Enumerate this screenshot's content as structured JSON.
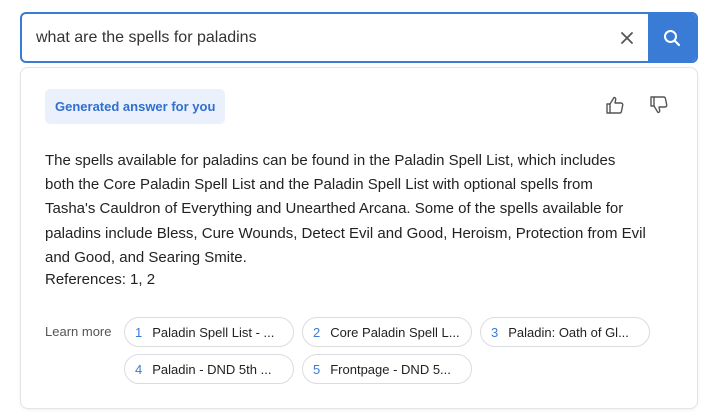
{
  "search": {
    "query": "what are the spells for paladins"
  },
  "answer_card": {
    "badge": "Generated answer for you",
    "lines": [
      "The spells available for paladins can be found in the Paladin Spell List, which includes",
      "both the Core Paladin Spell List and the Paladin Spell List with optional spells from",
      "Tasha's Cauldron of Everything and Unearthed Arcana. Some of the spells available for",
      "paladins include Bless, Cure Wounds, Detect Evil and Good, Heroism, Protection from Evil",
      "and Good, and Searing Smite."
    ],
    "references": "References: 1, 2",
    "learn_more_label": "Learn more",
    "sources": [
      {
        "num": "1",
        "title": "Paladin Spell List - ..."
      },
      {
        "num": "2",
        "title": "Core Paladin Spell L..."
      },
      {
        "num": "3",
        "title": "Paladin: Oath of Gl..."
      },
      {
        "num": "4",
        "title": "Paladin - DND 5th ..."
      },
      {
        "num": "5",
        "title": "Frontpage - DND 5..."
      }
    ]
  },
  "icons": {
    "clear": "close-icon",
    "search": "search-icon",
    "like": "thumbs-up-icon",
    "dislike": "thumbs-down-icon"
  },
  "colors": {
    "accent": "#3a7bd5",
    "badge_bg": "#eaf1fc",
    "badge_text": "#2f6fce"
  }
}
